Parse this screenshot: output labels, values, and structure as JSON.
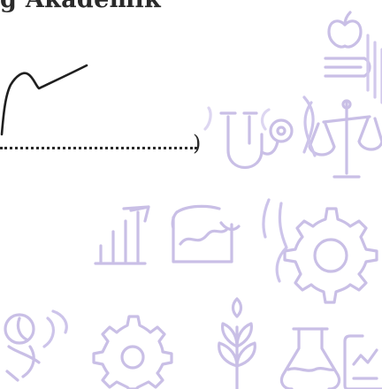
{
  "header": {
    "partial_title": "g Akademik"
  },
  "body": {
    "closing_paren": ")"
  },
  "colors": {
    "ink": "#2a2a2a",
    "icon_stroke": "#c9bfe6",
    "icon_stroke_light": "#ddd6f1"
  },
  "icons": [
    "apple-on-books-icon",
    "stacked-books-icon",
    "stethoscope-icon",
    "balance-scale-icon",
    "bar-chart-growth-icon",
    "graph-presentation-icon",
    "gear-icon",
    "gear-partial-icon",
    "dna-helix-icon",
    "flask-icon",
    "magnifier-plant-icon",
    "gear-small-icon",
    "leaf-plant-icon",
    "document-chart-icon",
    "open-book-icon",
    "leaf-branch-icon"
  ]
}
